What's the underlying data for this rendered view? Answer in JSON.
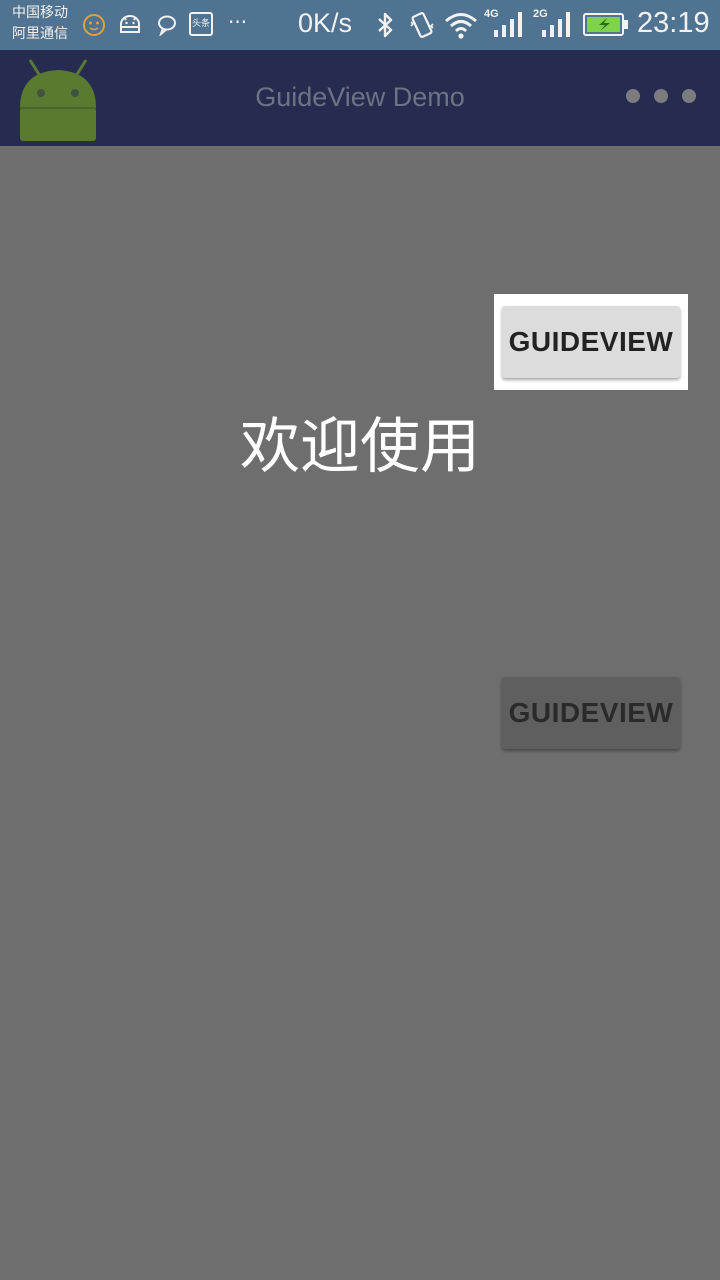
{
  "status_bar": {
    "carrier_line1": "中国移动",
    "carrier_line2": "阿里通信",
    "notification_icons": [
      "emoji-icon",
      "android-icon",
      "chat-bubble-icon",
      "toutiao-icon",
      "more-dots-icon"
    ],
    "toutiao_label": "头条",
    "more_label": "···",
    "net_speed": "0K/s",
    "sim1_network": "4G",
    "sim2_network": "2G",
    "time": "23:19"
  },
  "app_bar": {
    "title": "GuideView Demo",
    "logo_icon": "android-robot-icon",
    "menu_icon": "overflow-menu-icon"
  },
  "main": {
    "top_button_label": "GUIDEVIEW",
    "welcome_text": "欢迎使用",
    "bottom_button_label": "GUIDEVIEW"
  },
  "colors": {
    "overlay_background": "#6e6e6e",
    "status_bar": "#4f7390",
    "app_bar": "#252c4f",
    "highlight": "#ffffff",
    "battery": "#7fd34a"
  }
}
